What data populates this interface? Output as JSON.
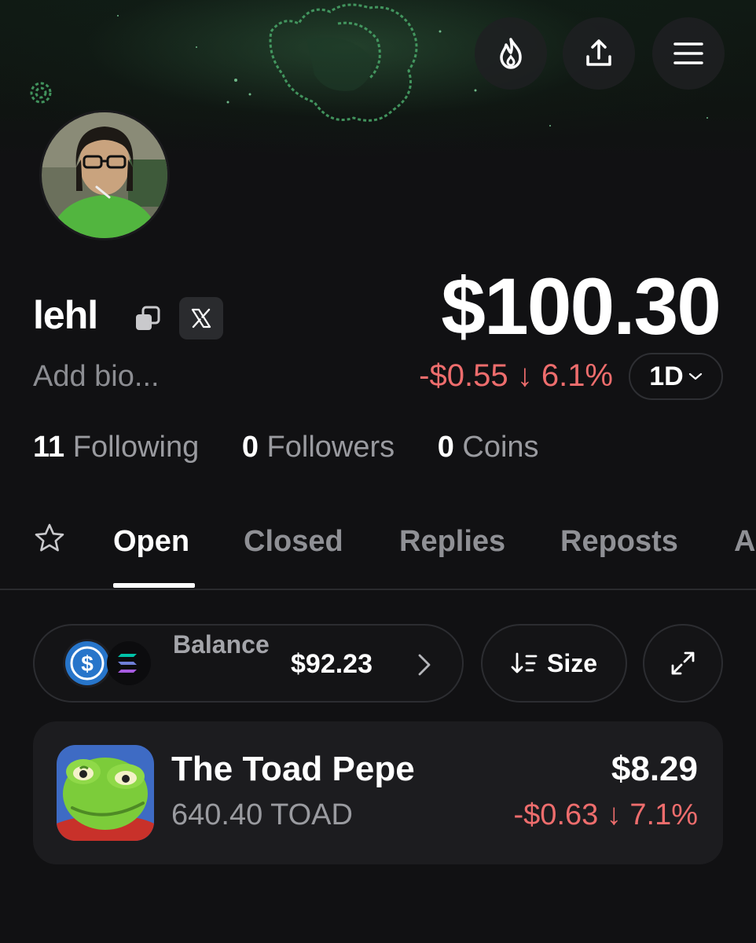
{
  "header": {
    "buttons": [
      {
        "icon": "flame-icon"
      },
      {
        "icon": "share-icon"
      },
      {
        "icon": "menu-icon"
      }
    ]
  },
  "profile": {
    "username": "lehl",
    "bio_placeholder": "Add bio...",
    "x_badge": "X"
  },
  "portfolio": {
    "value": "$100.30",
    "change_amount": "-$0.55",
    "change_arrow": "↓",
    "change_percent": "6.1%",
    "period": "1D",
    "negative_color": "#ee6d6d"
  },
  "stats": {
    "following_count": "11",
    "following_label": "Following",
    "followers_count": "0",
    "followers_label": "Followers",
    "coins_count": "0",
    "coins_label": "Coins"
  },
  "tabs": [
    {
      "label": "Open",
      "active": true
    },
    {
      "label": "Closed",
      "active": false
    },
    {
      "label": "Replies",
      "active": false
    },
    {
      "label": "Reposts",
      "active": false
    },
    {
      "label": "A",
      "active": false
    }
  ],
  "balance": {
    "label": "Balance",
    "value": "$92.23"
  },
  "sort": {
    "label": "Size"
  },
  "holdings": [
    {
      "name": "The Toad Pepe",
      "amount": "640.40 TOAD",
      "value": "$8.29",
      "change": "-$0.63 ↓ 7.1%"
    }
  ]
}
